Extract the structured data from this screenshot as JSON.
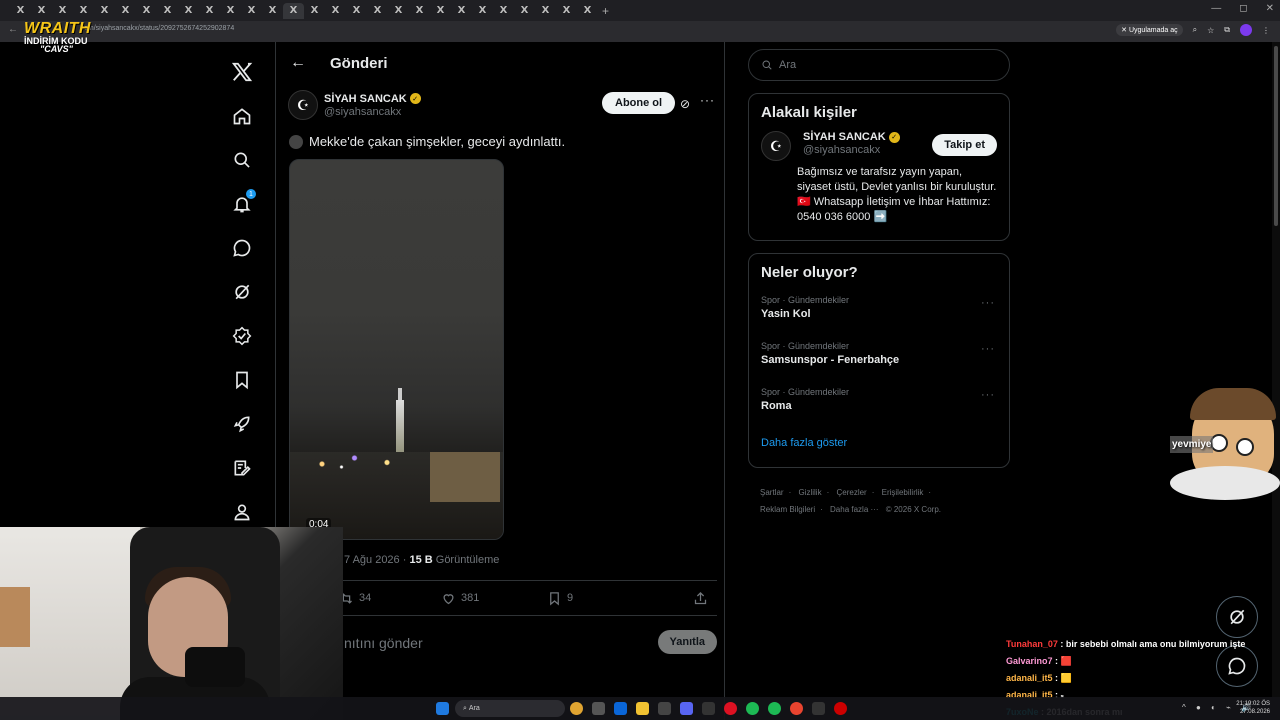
{
  "browser": {
    "tab_glyph": "X",
    "new_tab": "+",
    "window_controls": [
      "—",
      "◻",
      "✕"
    ],
    "url": "x.com/siyahsancakx/status/2092752674252902874",
    "url_visible": "om/siyahsancakx/status/2092752674252902874",
    "app_badge": "Uygulamada aç"
  },
  "overlay_logo": {
    "brand": "WRAITH",
    "line1": "İNDİRİM KODU",
    "line2": "\"CAVS\""
  },
  "nav": {
    "notification_count": "1",
    "items": [
      "x-logo",
      "home",
      "explore",
      "notifications",
      "messages",
      "grok",
      "premium",
      "bookmarks",
      "jobs",
      "lists",
      "profile"
    ]
  },
  "header": {
    "back": "←",
    "title": "Gönderi"
  },
  "tweet": {
    "author_name": "SİYAH SANCAK",
    "author_handle": "@siyahsancakx",
    "subscribe_label": "Abone ol",
    "text": "Mekke'de çakan şimşekler, geceyi aydınlattı.",
    "video_time": "0:04",
    "date": "7 Ağu 2026 · ",
    "views_count": "15 B",
    "views_label": " Görüntüleme",
    "retweets": "34",
    "likes": "381",
    "bookmarks": "9",
    "reply_placeholder": "nıtını gönder",
    "reply_button": "Yanıtla"
  },
  "search": {
    "placeholder": "Ara"
  },
  "relevant_people": {
    "title": "Alakalı kişiler",
    "name": "SİYAH SANCAK",
    "handle": "@siyahsancakx",
    "follow_label": "Takip et",
    "bio": "Bağımsız ve tarafsız yayın yapan, siyaset üstü, Devlet yanlısı bir kuruluştur. 🇹🇷 Whatsapp İletişim ve İhbar Hattımız: 0540 036 6000 ➡️"
  },
  "trends": {
    "title": "Neler oluyor?",
    "items": [
      {
        "category": "Spor · Gündemdekiler",
        "name": "Yasin Kol"
      },
      {
        "category": "Spor · Gündemdekiler",
        "name": "Samsunspor - Fenerbahçe"
      },
      {
        "category": "Spor · Gündemdekiler",
        "name": "Roma"
      }
    ],
    "show_more": "Daha fazla göster"
  },
  "footer": {
    "links": [
      "Şartlar",
      "Gizlilik",
      "Çerezler",
      "Erişilebilirlik",
      "Reklam Bilgileri",
      "Daha fazla ···",
      "© 2026 X Corp."
    ]
  },
  "sticker": {
    "label": "yevmiye"
  },
  "chat": [
    {
      "user": "Tunahan_07",
      "color": "#ff3b3b",
      "text": "bir sebebi olmalı ama onu bilmiyorum işte"
    },
    {
      "user": "Galvarino7",
      "color": "#ff9ad5",
      "text": "🟥"
    },
    {
      "user": "adanali_it5",
      "color": "#ffb648",
      "text": "🟨"
    },
    {
      "user": "adanali_it5",
      "color": "#ffb648",
      "text": "ₛ"
    },
    {
      "user": "7uxoNe",
      "color": "#00e5ff",
      "text": "2016dan sonra mı"
    }
  ],
  "taskbar": {
    "search_placeholder": "Ara",
    "time": "21:19:02 ÖS",
    "date": "27.08.2026"
  },
  "colors": {
    "background": "#000000",
    "border": "#2f3336",
    "text": "#e7e9ea",
    "muted": "#71767b",
    "accent": "#1d9bf0",
    "verified": "#e2b719"
  }
}
